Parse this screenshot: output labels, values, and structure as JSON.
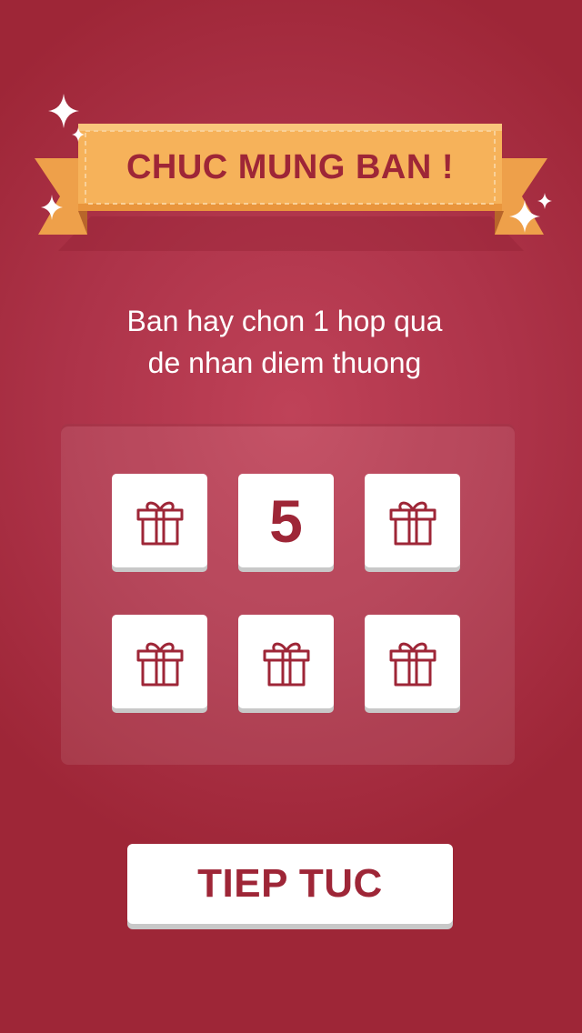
{
  "banner": {
    "title": "CHUC MUNG BAN !"
  },
  "prompt": {
    "line1": "Ban hay chon 1 hop qua",
    "line2": "de nhan diem thuong"
  },
  "gift_grid": {
    "revealed_value": "5",
    "boxes": [
      {
        "state": "closed",
        "icon": "gift-icon"
      },
      {
        "state": "revealed",
        "value": "5"
      },
      {
        "state": "closed",
        "icon": "gift-icon"
      },
      {
        "state": "closed",
        "icon": "gift-icon"
      },
      {
        "state": "closed",
        "icon": "gift-icon"
      },
      {
        "state": "closed",
        "icon": "gift-icon"
      }
    ]
  },
  "actions": {
    "continue_label": "TIEP TUC"
  },
  "colors": {
    "background": "#ad3349",
    "accent": "#9e2637",
    "ribbon": "#f6b25a",
    "ribbon_dark": "#e9953c",
    "tile": "#ffffff"
  }
}
